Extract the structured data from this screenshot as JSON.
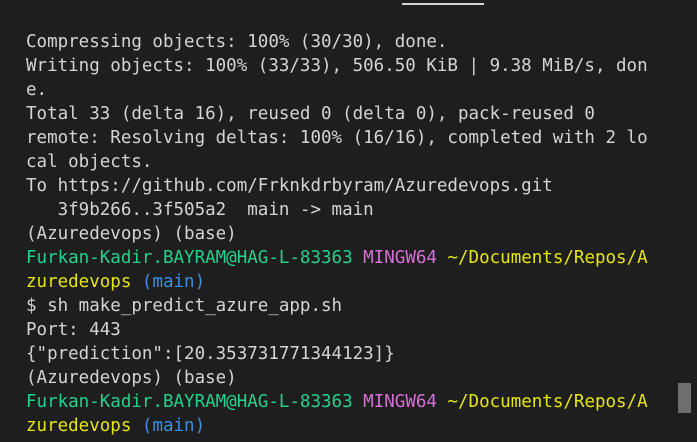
{
  "terminal": {
    "lines": [
      [
        {
          "t": "Compressing objects: 100% (30/30), done.",
          "c": "default"
        }
      ],
      [
        {
          "t": "Writing objects: 100% (33/33), 506.50 KiB | 9.38 MiB/s, don",
          "c": "default"
        }
      ],
      [
        {
          "t": "e.",
          "c": "default"
        }
      ],
      [
        {
          "t": "Total 33 (delta 16), reused 0 (delta 0), pack-reused 0",
          "c": "default"
        }
      ],
      [
        {
          "t": "remote: Resolving deltas: 100% (16/16), completed with 2 lo",
          "c": "default"
        }
      ],
      [
        {
          "t": "cal objects.",
          "c": "default"
        }
      ],
      [
        {
          "t": "To https://github.com/Frknkdrbyram/Azuredevops.git",
          "c": "default"
        }
      ],
      [
        {
          "t": "   3f9b266..3f505a2  main -> main",
          "c": "default"
        }
      ],
      [
        {
          "t": "(Azuredevops) (base)",
          "c": "default"
        }
      ],
      [
        {
          "t": "Furkan-Kadir.BAYRAM@HAG-L-83363",
          "c": "green"
        },
        {
          "t": " ",
          "c": "default"
        },
        {
          "t": "MINGW64",
          "c": "magenta"
        },
        {
          "t": " ",
          "c": "default"
        },
        {
          "t": "~/Documents/Repos/A",
          "c": "yellow"
        }
      ],
      [
        {
          "t": "zuredevops",
          "c": "yellow"
        },
        {
          "t": " ",
          "c": "default"
        },
        {
          "t": "(main)",
          "c": "cyan"
        }
      ],
      [
        {
          "t": "$ sh make_predict_azure_app.sh",
          "c": "default"
        }
      ],
      [
        {
          "t": "Port: 443",
          "c": "default"
        }
      ],
      [
        {
          "t": "{\"prediction\":[20.353731771344123]}",
          "c": "default"
        }
      ],
      [
        {
          "t": "(Azuredevops) (base)",
          "c": "default"
        }
      ],
      [
        {
          "t": "Furkan-Kadir.BAYRAM@HAG-L-83363",
          "c": "green"
        },
        {
          "t": " ",
          "c": "default"
        },
        {
          "t": "MINGW64",
          "c": "magenta"
        },
        {
          "t": " ",
          "c": "default"
        },
        {
          "t": "~/Documents/Repos/A",
          "c": "yellow"
        }
      ],
      [
        {
          "t": "zuredevops",
          "c": "yellow"
        },
        {
          "t": " ",
          "c": "default"
        },
        {
          "t": "(main)",
          "c": "cyan"
        }
      ]
    ]
  },
  "colors": {
    "background": "#1e1e1e",
    "text": "#d4d4d4",
    "user_host": "#23d18b",
    "shell": "#d670d6",
    "path": "#e5e510",
    "branch": "#3b8eea"
  }
}
